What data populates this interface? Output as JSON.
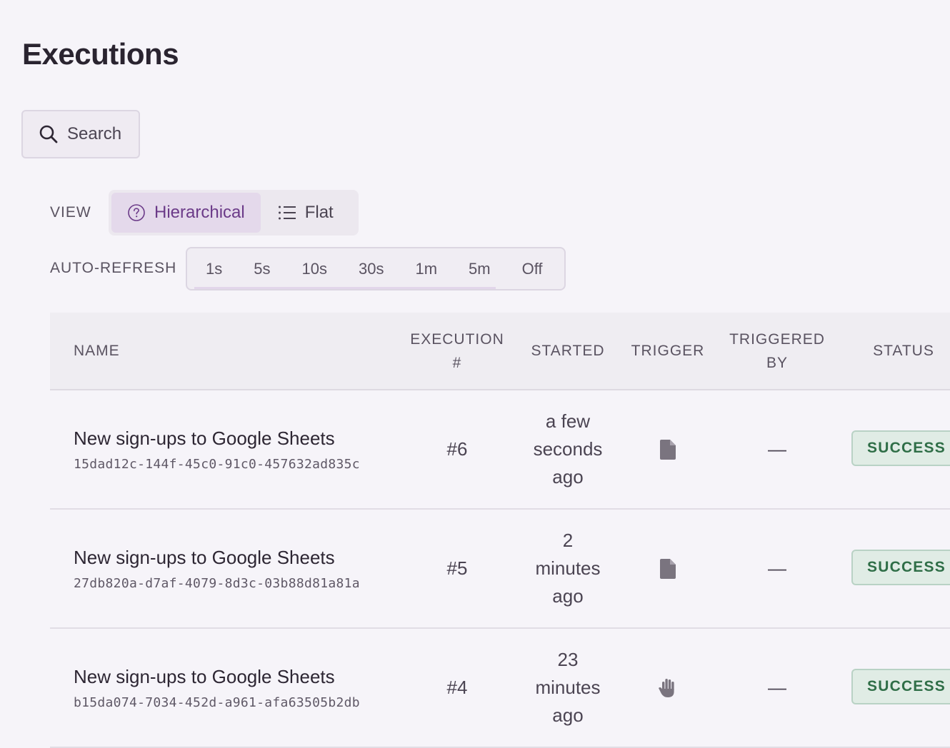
{
  "page": {
    "title": "Executions"
  },
  "search": {
    "label": "Search",
    "icon": "search-icon"
  },
  "view": {
    "label": "VIEW",
    "options": [
      {
        "label": "Hierarchical",
        "icon": "help-circle-icon",
        "active": true
      },
      {
        "label": "Flat",
        "icon": "list-icon",
        "active": false
      }
    ]
  },
  "auto_refresh": {
    "label": "AUTO-REFRESH",
    "options": [
      "1s",
      "5s",
      "10s",
      "30s",
      "1m",
      "5m",
      "Off"
    ]
  },
  "table": {
    "headers": {
      "name": "NAME",
      "execution": "EXECUTION #",
      "started": "STARTED",
      "trigger": "TRIGGER",
      "triggered_by": "TRIGGERED BY",
      "status": "STATUS"
    },
    "rows": [
      {
        "name": "New sign-ups to Google Sheets",
        "id": "15dad12c-144f-45c0-91c0-457632ad835c",
        "execution": "#6",
        "started": "a few seconds ago",
        "trigger_icon": "file-icon",
        "triggered_by": "—",
        "status": "SUCCESS"
      },
      {
        "name": "New sign-ups to Google Sheets",
        "id": "27db820a-d7af-4079-8d3c-03b88d81a81a",
        "execution": "#5",
        "started": "2 minutes ago",
        "trigger_icon": "file-icon",
        "triggered_by": "—",
        "status": "SUCCESS"
      },
      {
        "name": "New sign-ups to Google Sheets",
        "id": "b15da074-7034-452d-a961-afa63505b2db",
        "execution": "#4",
        "started": "23 minutes ago",
        "trigger_icon": "hand-icon",
        "triggered_by": "—",
        "status": "SUCCESS"
      }
    ]
  },
  "colors": {
    "background": "#f6f4f9",
    "accent": "#6b3a88",
    "success_text": "#2f6e47",
    "success_bg": "#e0ece5"
  }
}
